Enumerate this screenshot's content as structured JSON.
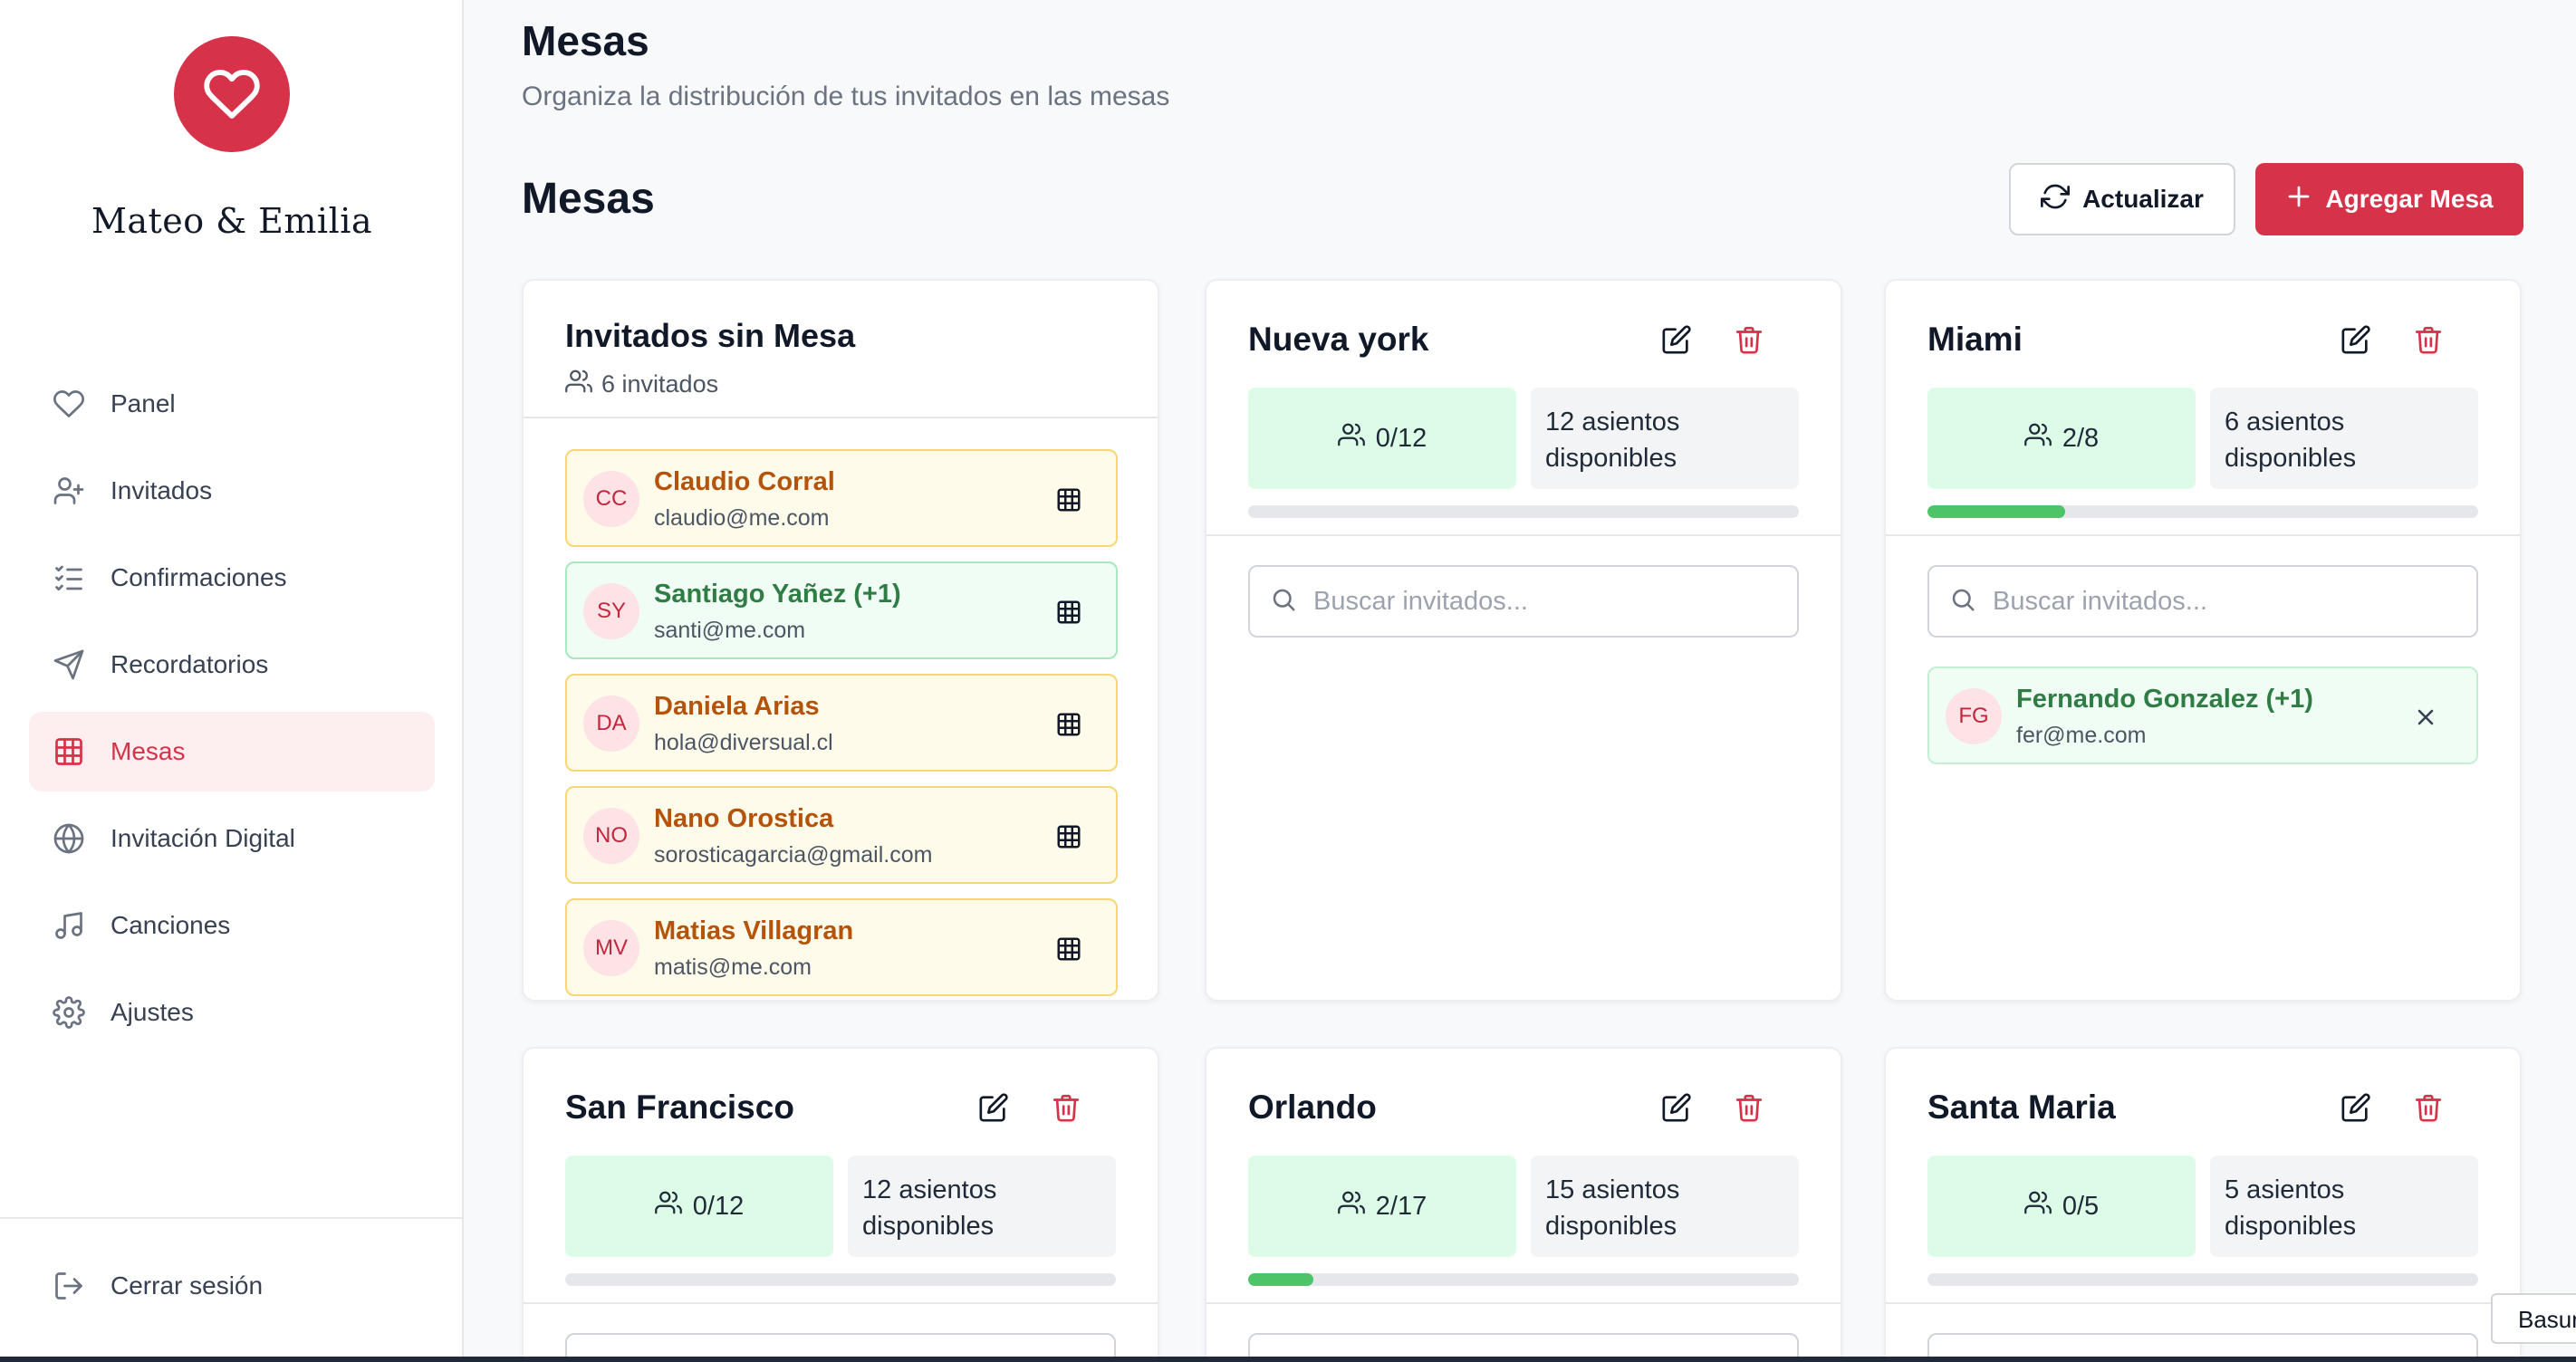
{
  "sidebar": {
    "brand": "Mateo & Emilia",
    "items": [
      {
        "label": "Panel",
        "icon": "heart-icon"
      },
      {
        "label": "Invitados",
        "icon": "user-plus-icon"
      },
      {
        "label": "Confirmaciones",
        "icon": "list-check-icon"
      },
      {
        "label": "Recordatorios",
        "icon": "send-icon"
      },
      {
        "label": "Mesas",
        "icon": "grid-icon",
        "active": true
      },
      {
        "label": "Invitación Digital",
        "icon": "globe-icon"
      },
      {
        "label": "Canciones",
        "icon": "music-icon"
      },
      {
        "label": "Ajustes",
        "icon": "gear-icon"
      }
    ],
    "logout": "Cerrar sesión"
  },
  "header": {
    "title": "Mesas",
    "subtitle": "Organiza la distribución de tus invitados en las mesas"
  },
  "section": {
    "title": "Mesas",
    "refresh_label": "Actualizar",
    "add_label": "Agregar Mesa"
  },
  "unassigned": {
    "title": "Invitados sin Mesa",
    "count_label": "6 invitados",
    "guests": [
      {
        "initials": "CC",
        "name": "Claudio Corral",
        "email": "claudio@me.com",
        "status": "pending"
      },
      {
        "initials": "SY",
        "name": "Santiago Yañez (+1)",
        "email": "santi@me.com",
        "status": "confirmed"
      },
      {
        "initials": "DA",
        "name": "Daniela Arias",
        "email": "hola@diversual.cl",
        "status": "pending"
      },
      {
        "initials": "NO",
        "name": "Nano Orostica",
        "email": "sorosticagarcia@gmail.com",
        "status": "pending"
      },
      {
        "initials": "MV",
        "name": "Matias Villagran",
        "email": "matis@me.com",
        "status": "pending"
      }
    ]
  },
  "tables": [
    {
      "name": "Nueva york",
      "occupancy": "0/12",
      "available": "12 asientos disponibles",
      "fill": 0,
      "search_placeholder": "Buscar invitados...",
      "guests": []
    },
    {
      "name": "Miami",
      "occupancy": "2/8",
      "available": "6 asientos disponibles",
      "fill": 0.25,
      "search_placeholder": "Buscar invitados...",
      "guests": [
        {
          "initials": "FG",
          "name": "Fernando Gonzalez (+1)",
          "email": "fer@me.com"
        }
      ]
    },
    {
      "name": "San Francisco",
      "occupancy": "0/12",
      "available": "12 asientos disponibles",
      "fill": 0
    },
    {
      "name": "Orlando",
      "occupancy": "2/17",
      "available": "15 asientos disponibles",
      "fill": 0.1176
    },
    {
      "name": "Santa Maria",
      "occupancy": "0/5",
      "available": "5 asientos disponibles",
      "fill": 0
    }
  ],
  "tooltip": "Basura",
  "colors": {
    "accent": "#d6334a",
    "success": "#4cc467",
    "pending_border": "#f7d774"
  }
}
